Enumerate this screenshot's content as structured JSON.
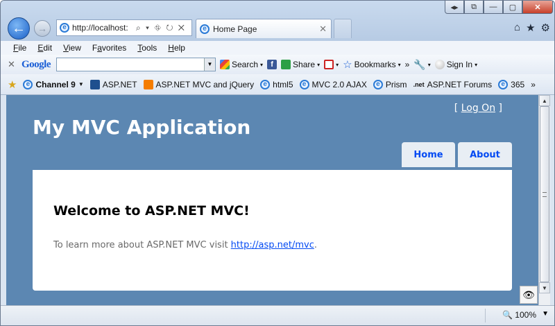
{
  "window": {
    "caption_buttons": [
      "◂▸",
      "⧉",
      "—",
      "▢",
      "✕"
    ]
  },
  "navigation": {
    "address_url": "http://localhost:",
    "address_tools": "⌕ ▾ ⛗ ↻ ✕",
    "tab_title": "Home Page",
    "tab_close": "✕"
  },
  "menubar": {
    "items": [
      {
        "hotkey": "F",
        "rest": "ile"
      },
      {
        "hotkey": "E",
        "rest": "dit"
      },
      {
        "hotkey": "V",
        "rest": "iew"
      },
      {
        "hotkey": "",
        "rest": "Favorites",
        "prefix": "F",
        "after": "a",
        "tail": "vorites"
      },
      {
        "hotkey": "T",
        "rest": "ools"
      },
      {
        "hotkey": "H",
        "rest": "elp"
      }
    ]
  },
  "google_toolbar": {
    "close": "✕",
    "logo": "Google",
    "search_value": "",
    "search_label": "Search",
    "share_label": "Share",
    "bookmarks_label": "Bookmarks",
    "more_label": "»",
    "signin_label": "Sign In"
  },
  "favorites": {
    "items": [
      "Channel 9",
      "ASP.NET",
      "ASP.NET MVC and jQuery",
      "html5",
      "MVC 2.0 AJAX",
      "Prism",
      "ASP.NET Forums",
      "365"
    ],
    "more": "»"
  },
  "page": {
    "login_open": "[",
    "login_link": "Log On",
    "login_close": "]",
    "app_title": "My MVC Application",
    "nav_tabs": [
      "Home",
      "About"
    ],
    "heading": "Welcome to ASP.NET MVC!",
    "body_text": "To learn more about ASP.NET MVC visit ",
    "body_link": "http://asp.net/mvc",
    "body_end": "."
  },
  "statusbar": {
    "zoom": "100%"
  },
  "colors": {
    "page_background": "#5c87b2",
    "link": "#034af3"
  }
}
